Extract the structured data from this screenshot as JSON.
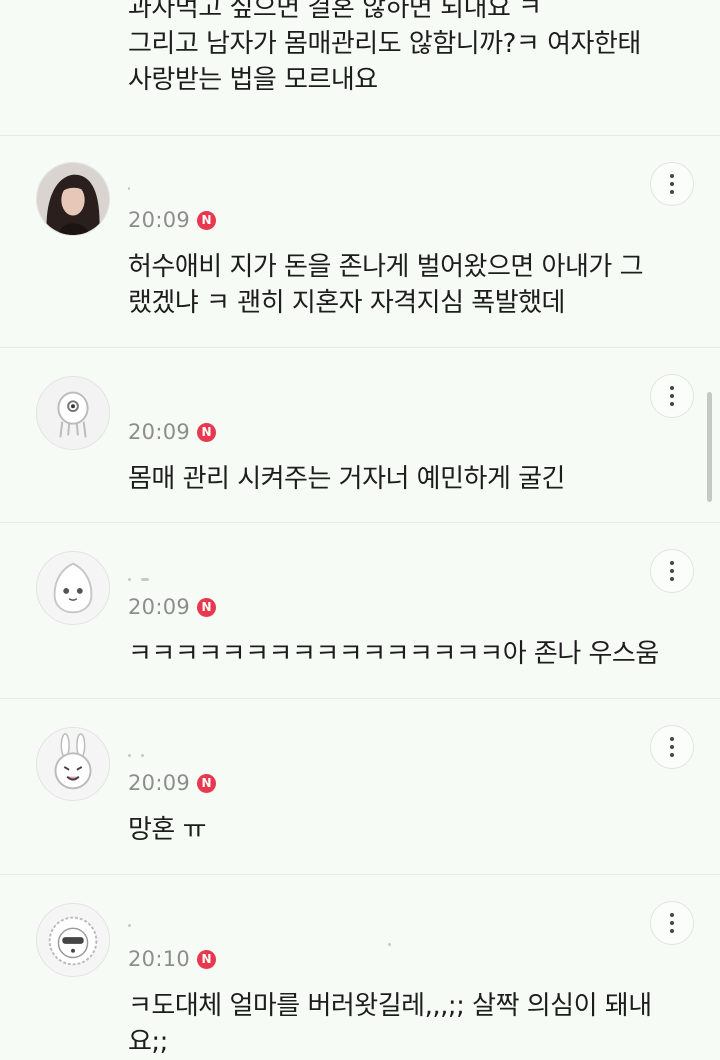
{
  "top_comment": {
    "lines": [
      "과자먹고 싶으면 결혼 않하면 되내요 ㅋ",
      "그리고 남자가 몸매관리도 않함니까?ㅋ 여자한태",
      "사랑받는 법을 모르내요"
    ]
  },
  "comments": [
    {
      "time": "20:09",
      "badge": "N",
      "avatar_icon": "woman-photo-avatar",
      "lines": [
        "허수애비 지가 돈을 존나게 벌어왔으면 아내가 그",
        "랬겠냐 ㅋ 괜히 지혼자 자격지심 폭발했데"
      ]
    },
    {
      "time": "20:09",
      "badge": "N",
      "avatar_icon": "one-eyed-character-avatar",
      "lines": [
        "몸매 관리 시켜주는 거자너 예민하게 굴긴"
      ]
    },
    {
      "time": "20:09",
      "badge": "N",
      "avatar_icon": "apeach-character-avatar",
      "lines": [
        "ㅋㅋㅋㅋㅋㅋㅋㅋㅋㅋㅋㅋㅋㅋㅋㅋ아 존나 우스움"
      ]
    },
    {
      "time": "20:09",
      "badge": "N",
      "avatar_icon": "rabbit-character-avatar",
      "lines": [
        "망혼 ㅠ"
      ]
    },
    {
      "time": "20:10",
      "badge": "N",
      "avatar_icon": "lion-character-avatar",
      "lines": [
        "ㅋ도대체 얼마를 버러왓길레,,,;; 살짝 의심이 돼내",
        "요;;"
      ]
    }
  ],
  "colors": {
    "background": "#f7fbf6",
    "badge": "#e8384f",
    "meta_text": "#8d8d8d"
  }
}
